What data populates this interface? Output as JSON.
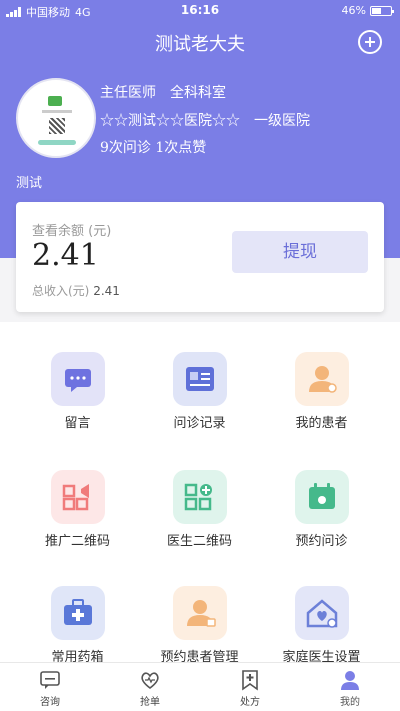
{
  "status_bar": {
    "carrier": "中国移动",
    "network": "4G",
    "time": "16:16",
    "battery": "46%"
  },
  "header": {
    "title": "测试老大夫"
  },
  "doctor": {
    "title_line": "主任医师　全科科室",
    "hospital_line": "☆☆测试☆☆医院☆☆　一级医院",
    "stats_line": "9次问诊 1次点赞",
    "name": "测试"
  },
  "balance": {
    "label": "查看余额 (元)",
    "value": "2.41",
    "total_label": "总收入(元)",
    "total_value": "2.41",
    "withdraw_label": "提现"
  },
  "grid": [
    {
      "label": "留言",
      "icon": "message-icon"
    },
    {
      "label": "问诊记录",
      "icon": "record-card-icon"
    },
    {
      "label": "我的患者",
      "icon": "patient-icon"
    },
    {
      "label": "推广二维码",
      "icon": "promo-qr-icon"
    },
    {
      "label": "医生二维码",
      "icon": "doctor-qr-icon"
    },
    {
      "label": "预约问诊",
      "icon": "calendar-icon"
    },
    {
      "label": "常用药箱",
      "icon": "medicine-box-icon"
    },
    {
      "label": "预约患者管理",
      "icon": "appointment-patient-icon"
    },
    {
      "label": "家庭医生设置",
      "icon": "family-doctor-icon"
    }
  ],
  "tabbar": [
    {
      "label": "咨询",
      "icon": "chat-icon"
    },
    {
      "label": "抢单",
      "icon": "heart-icon"
    },
    {
      "label": "处方",
      "icon": "prescription-icon"
    },
    {
      "label": "我的",
      "icon": "user-icon"
    }
  ],
  "colors": {
    "primary": "#7b7ee6",
    "withdraw_bg": "#e4e5f8",
    "withdraw_text": "#6a6ed8"
  }
}
